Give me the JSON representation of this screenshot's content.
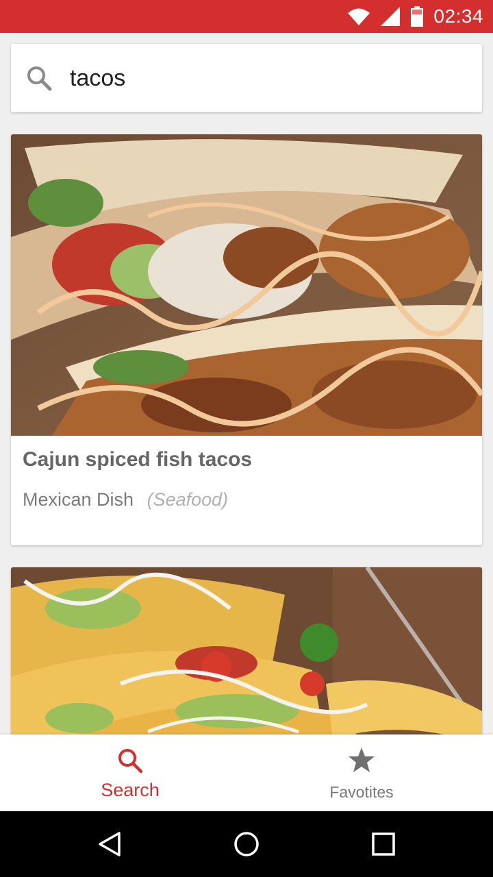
{
  "status_bar": {
    "time": "02:34",
    "icons": [
      "wifi-icon",
      "signal-icon",
      "battery-icon"
    ]
  },
  "search": {
    "value": "tacos",
    "icon": "search-icon"
  },
  "results": [
    {
      "title": "Cajun spiced fish tacos",
      "category": "Mexican Dish",
      "tag": "(Seafood)",
      "image": "photo of fish tacos with slaw, tomato and sauce"
    },
    {
      "title": "",
      "category": "",
      "tag": "",
      "image": "photo of crunchy tacos with cheese, tomato and jalapeño"
    }
  ],
  "bottom_nav": {
    "items": [
      {
        "label": "Search",
        "icon": "search-icon",
        "active": true
      },
      {
        "label": "Favotites",
        "icon": "star-icon",
        "active": false
      }
    ]
  },
  "system_nav": [
    "back-icon",
    "home-icon",
    "recents-icon"
  ],
  "colors": {
    "accent": "#d32f2f",
    "background": "#efefef",
    "card": "#ffffff",
    "text_title": "#666666",
    "text_secondary": "#7a7a7a",
    "text_hint": "#b0b0b0"
  }
}
